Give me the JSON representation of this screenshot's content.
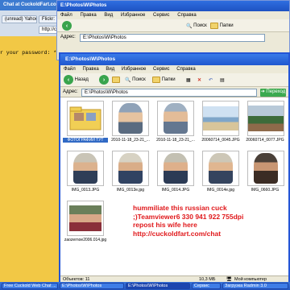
{
  "opera": {
    "title": "Chat at CuckoldFart.com - Opera",
    "tabs": [
      "(unread) Yahoo! ...",
      "Flickr: Explore",
      "http://cuckoldfart.com/c"
    ],
    "prompt": "r your password: ******"
  },
  "back_window": {
    "title": "E:\\Photos\\W\\Photos",
    "menu": [
      "Файл",
      "Правка",
      "Вид",
      "Избранное",
      "Сервис",
      "Справка"
    ],
    "search_label": "Поиск",
    "folders_label": "Папки",
    "address_label": "Адрес:",
    "address_value": "E:\\Photos\\W\\Photos"
  },
  "front_window": {
    "title": "E:\\Photos\\W\\Photos",
    "menu": [
      "Файл",
      "Правка",
      "Вид",
      "Избранное",
      "Сервис",
      "Справка"
    ],
    "back_label": "Назад",
    "search_label": "Поиск",
    "folders_label": "Папки",
    "address_label": "Адрес:",
    "address_value": "E:\\Photos\\W\\Photos",
    "go_label": "Переход",
    "thumbnails": [
      {
        "caption": "ФОТОГРАФИИ ТУТ"
      },
      {
        "caption": "2010-11-18_23-21_..."
      },
      {
        "caption": "2010-11-18_23-21_..."
      },
      {
        "caption": "20060714_0045.JPG"
      },
      {
        "caption": "20060714_0077.JPG"
      },
      {
        "caption": "IMG_0013.JPG"
      },
      {
        "caption": "IMG_0013e.jpg"
      },
      {
        "caption": "IMG_0014.JPG"
      },
      {
        "caption": "IMG_0014e.jpg"
      },
      {
        "caption": "IMG_0660.JPG"
      },
      {
        "caption": "zaozernoe2006.014.jpg"
      }
    ],
    "status_objects": "Объектов: 11",
    "status_size": "10,3 МБ",
    "status_location": "Мой компьютер"
  },
  "spam": {
    "line1": "hummiliate this russian cuck",
    "line2": ";)Teamviewer6 330 941 922  755dpi",
    "line3": "repost his wife here",
    "line4": "http://cuckoldfart.com/chat"
  },
  "taskbar": {
    "items": [
      "Free Cuckold Web Chat ...",
      "E:\\Photos\\W\\Photos",
      "E:\\Photos\\W\\Photos",
      "Сервис",
      "Загрузка Radmin 3.0"
    ]
  },
  "colors": {
    "opera_bg": "#f2c845",
    "title_blue": "#2455d6",
    "spam_red": "#e0181b"
  }
}
